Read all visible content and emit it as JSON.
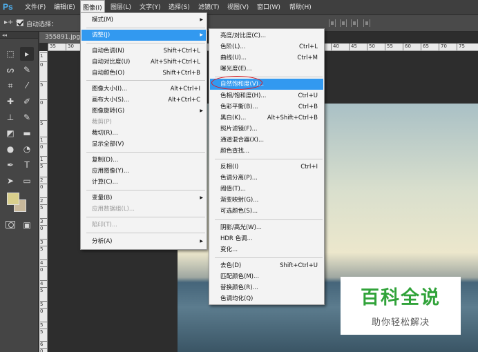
{
  "app": {
    "logo": "Ps"
  },
  "menubar": [
    {
      "id": "file",
      "label": "文件(F)"
    },
    {
      "id": "edit",
      "label": "编辑(E)"
    },
    {
      "id": "image",
      "label": "图像(I)"
    },
    {
      "id": "layer",
      "label": "图层(L)"
    },
    {
      "id": "text",
      "label": "文字(Y)"
    },
    {
      "id": "select",
      "label": "选择(S)"
    },
    {
      "id": "filter",
      "label": "滤镜(T)"
    },
    {
      "id": "view",
      "label": "视图(V)"
    },
    {
      "id": "window",
      "label": "窗口(W)"
    },
    {
      "id": "help",
      "label": "帮助(H)"
    }
  ],
  "options": {
    "tool_glyph": "▸+ ▾",
    "auto_select_label": "自动选择："
  },
  "document": {
    "tab_label": "355891.jpg",
    "ruler_h": [
      "35",
      "30",
      "40",
      "45",
      "50",
      "55",
      "60",
      "65",
      "70",
      "75"
    ],
    "ruler_v": [
      "1",
      "0",
      "5",
      "0",
      "5",
      "1",
      "0",
      "1",
      "5",
      "2",
      "0",
      "2",
      "5",
      "3",
      "0",
      "3",
      "5",
      "4",
      "0",
      "4",
      "5",
      "5",
      "0",
      "5",
      "5",
      "6",
      "0"
    ]
  },
  "image_menu": {
    "items": [
      {
        "label": "模式(M)",
        "arrow": true
      },
      {
        "label": "调整(J)",
        "arrow": true,
        "highlight": true
      },
      {
        "label": "自动色调(N)",
        "shortcut": "Shift+Ctrl+L"
      },
      {
        "label": "自动对比度(U)",
        "shortcut": "Alt+Shift+Ctrl+L"
      },
      {
        "label": "自动颜色(O)",
        "shortcut": "Shift+Ctrl+B"
      },
      {
        "label": "图像大小(I)...",
        "shortcut": "Alt+Ctrl+I"
      },
      {
        "label": "画布大小(S)...",
        "shortcut": "Alt+Ctrl+C"
      },
      {
        "label": "图像旋转(G)",
        "arrow": true
      },
      {
        "label": "裁剪(P)",
        "disabled": true
      },
      {
        "label": "裁切(R)..."
      },
      {
        "label": "显示全部(V)"
      },
      {
        "label": "复制(D)..."
      },
      {
        "label": "应用图像(Y)..."
      },
      {
        "label": "计算(C)..."
      },
      {
        "label": "变量(B)",
        "arrow": true
      },
      {
        "label": "应用数据组(L)...",
        "disabled": true
      },
      {
        "label": "陷印(T)...",
        "disabled": true
      },
      {
        "label": "分析(A)",
        "arrow": true
      }
    ]
  },
  "adjust_menu": {
    "items": [
      {
        "label": "亮度/对比度(C)..."
      },
      {
        "label": "色阶(L)...",
        "shortcut": "Ctrl+L"
      },
      {
        "label": "曲线(U)...",
        "shortcut": "Ctrl+M"
      },
      {
        "label": "曝光度(E)..."
      },
      {
        "label": "自然饱和度(V)...",
        "highlight": true
      },
      {
        "label": "色相/饱和度(H)...",
        "shortcut": "Ctrl+U"
      },
      {
        "label": "色彩平衡(B)...",
        "shortcut": "Ctrl+B"
      },
      {
        "label": "黑白(K)...",
        "shortcut": "Alt+Shift+Ctrl+B"
      },
      {
        "label": "照片滤镜(F)..."
      },
      {
        "label": "通道混合器(X)..."
      },
      {
        "label": "颜色查找..."
      },
      {
        "label": "反相(I)",
        "shortcut": "Ctrl+I"
      },
      {
        "label": "色调分离(P)..."
      },
      {
        "label": "阈值(T)..."
      },
      {
        "label": "渐变映射(G)..."
      },
      {
        "label": "可选颜色(S)..."
      },
      {
        "label": "阴影/高光(W)..."
      },
      {
        "label": "HDR 色调..."
      },
      {
        "label": "变化..."
      },
      {
        "label": "去色(D)",
        "shortcut": "Shift+Ctrl+U"
      },
      {
        "label": "匹配颜色(M)..."
      },
      {
        "label": "替换颜色(R)..."
      },
      {
        "label": "色调均化(Q)"
      }
    ]
  },
  "watermark": {
    "title": "百科全说",
    "subtitle": "助你轻松解决"
  },
  "colors": {
    "foreground": "#d9cf8c",
    "background": "#c8b89a",
    "highlight": "#3299f0",
    "annotation": "#e0141e"
  }
}
